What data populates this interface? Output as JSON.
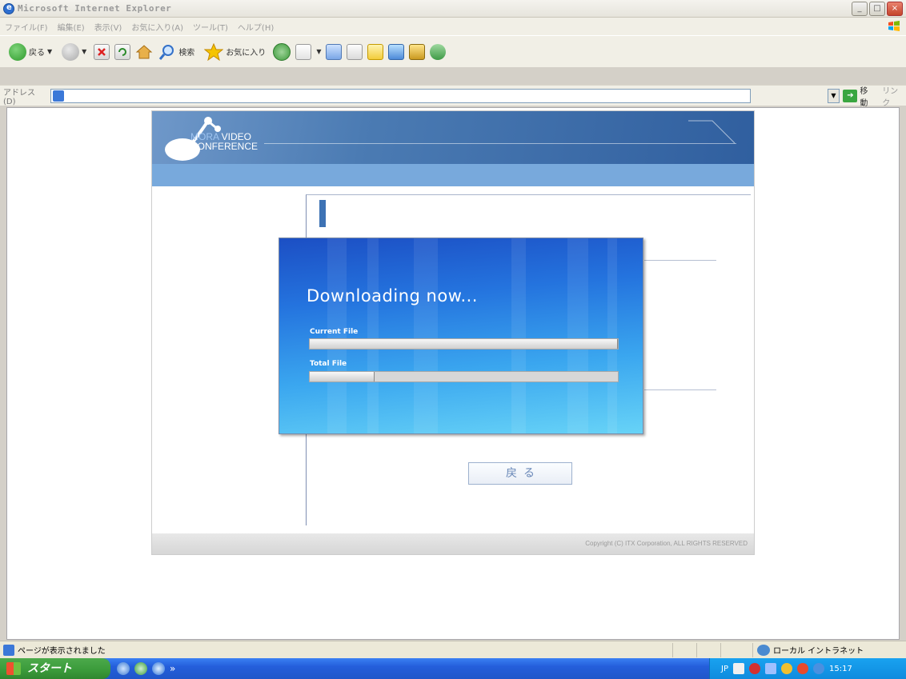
{
  "window": {
    "title": "Microsoft Internet Explorer",
    "buttons": {
      "minimize": "_",
      "maximize": "□",
      "close": "×"
    }
  },
  "menu": [
    "ファイル(F)",
    "編集(E)",
    "表示(V)",
    "お気に入り(A)",
    "ツール(T)",
    "ヘルプ(H)"
  ],
  "toolbar": {
    "back_label": "戻る",
    "search_label": "検索",
    "favorites_label": "お気に入り"
  },
  "address": {
    "label": "アドレス(D)",
    "go_label": "移動",
    "links_label": "リンク"
  },
  "page": {
    "logo_line1_prefix": "MORA",
    "logo_line1_suffix": " VIDEO",
    "logo_line2": "CONFERENCE",
    "back_button_label": "戻る",
    "copyright": "Copyright (C) ITX Corporation, ALL RIGHTS RESERVED"
  },
  "download": {
    "title": "Downloading now...",
    "current_label": "Current File",
    "current_progress": 1.0,
    "total_label": "Total File",
    "total_progress": 0.21
  },
  "status": {
    "text": "ページが表示されました",
    "zone": "ローカル イントラネット"
  },
  "taskbar": {
    "start_label": "スタート",
    "more": "»",
    "language": "JP",
    "clock": "15:17"
  }
}
